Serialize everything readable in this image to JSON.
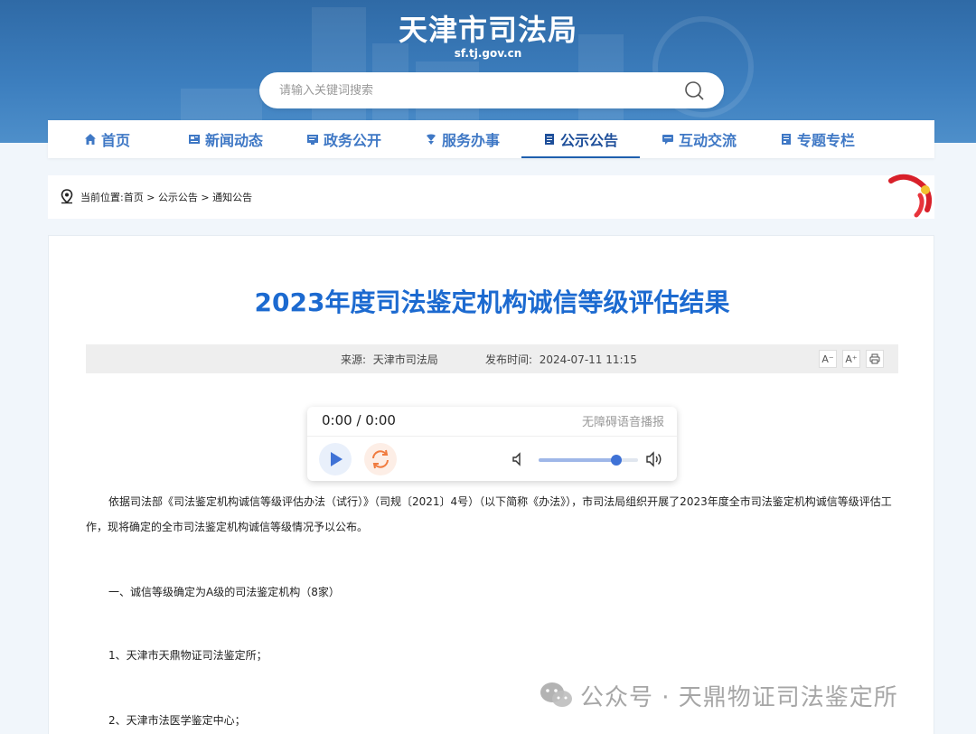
{
  "header": {
    "site_title": "天津市司法局",
    "site_domain": "sf.tj.gov.cn",
    "search_placeholder": "请输入关键词搜索"
  },
  "nav": {
    "items": [
      {
        "label": "首页",
        "icon": "home-icon"
      },
      {
        "label": "新闻动态",
        "icon": "news-icon"
      },
      {
        "label": "政务公开",
        "icon": "gov-icon"
      },
      {
        "label": "服务办事",
        "icon": "service-icon"
      },
      {
        "label": "公示公告",
        "icon": "notice-icon",
        "active": true
      },
      {
        "label": "互动交流",
        "icon": "chat-icon"
      },
      {
        "label": "专题专栏",
        "icon": "topic-icon"
      }
    ]
  },
  "breadcrumb": {
    "prefix": "当前位置:",
    "items": [
      "首页",
      "公示公告",
      "通知公告"
    ],
    "separator": " > "
  },
  "article": {
    "title": "2023年度司法鉴定机构诚信等级评估结果",
    "source_label": "来源:",
    "source": "天津市司法局",
    "time_label": "发布时间:",
    "time": "2024-07-11 11:15",
    "tools": [
      "A⁻",
      "A⁺"
    ],
    "paragraphs": [
      "依据司法部《司法鉴定机构诚信等级评估办法（试行）》（司规〔2021〕4号）（以下简称《办法》），市司法局组织开展了2023年度全市司法鉴定机构诚信等级评估工作，现将确定的全市司法鉴定机构诚信等级情况予以公布。",
      "一、诚信等级确定为A级的司法鉴定机构（8家）",
      "1、天津市天鼎物证司法鉴定所；",
      "2、天津市法医学鉴定中心；"
    ]
  },
  "player": {
    "time": "0:00 / 0:00",
    "label": "无障碍语音播报",
    "volume": 0.78
  },
  "watermark": {
    "text": "公众号 · 天鼎物证司法鉴定所"
  },
  "colors": {
    "banner": "#3d7fbf",
    "nav_text": "#3f78c5",
    "title": "#1c6ad0",
    "accent": "#3f72d6"
  }
}
